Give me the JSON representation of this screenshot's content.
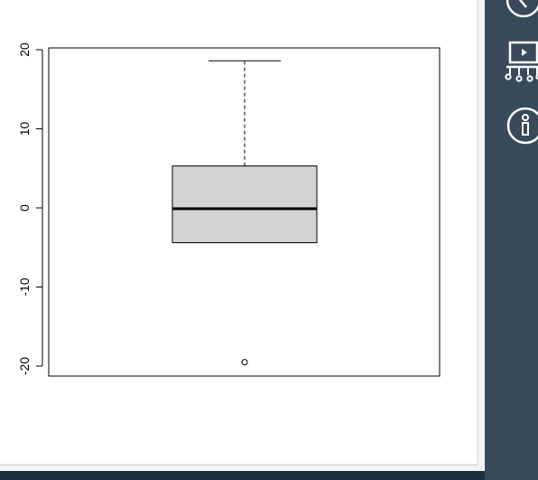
{
  "chart_data": {
    "type": "box",
    "title": "",
    "xlabel": "",
    "ylabel": "",
    "ylim": [
      -21,
      20
    ],
    "yticks": [
      -20,
      -10,
      0,
      10,
      20
    ],
    "ytick_labels": [
      "-20",
      "-10",
      "0",
      "10",
      "20"
    ],
    "box": {
      "whisker_low": -4.4,
      "q1": -4.4,
      "median": -0.1,
      "q3": 5.3,
      "whisker_high": 18.6,
      "outliers": [
        -19.5
      ]
    },
    "box_fill": "#d3d3d3"
  },
  "sidebar": {
    "icons": [
      "compass-icon",
      "presentation-icon",
      "info-icon"
    ]
  },
  "colors": {
    "sidebar_bg": "#384a59",
    "footer_bg": "#1c2f3a",
    "panel_bg": "#ffffff"
  }
}
